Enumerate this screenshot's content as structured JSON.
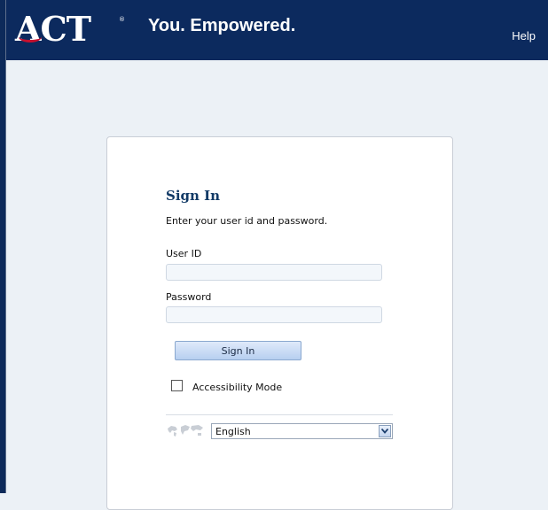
{
  "header": {
    "logo_text": "ACT",
    "logo_mark": "®",
    "tagline": "You. Empowered.",
    "help_label": "Help"
  },
  "signin": {
    "title": "Sign In",
    "instruction": "Enter your user id and password.",
    "userid_label": "User ID",
    "userid_value": "",
    "password_label": "Password",
    "password_value": "",
    "button_label": "Sign In",
    "accessibility_label": "Accessibility Mode",
    "accessibility_checked": false
  },
  "language": {
    "selected": "English",
    "icon": "globe-icon"
  },
  "colors": {
    "header_bg": "#0c2a5e",
    "page_bg": "#ecf1f6",
    "title_color": "#123a66",
    "logo_accent": "#c6102e"
  }
}
